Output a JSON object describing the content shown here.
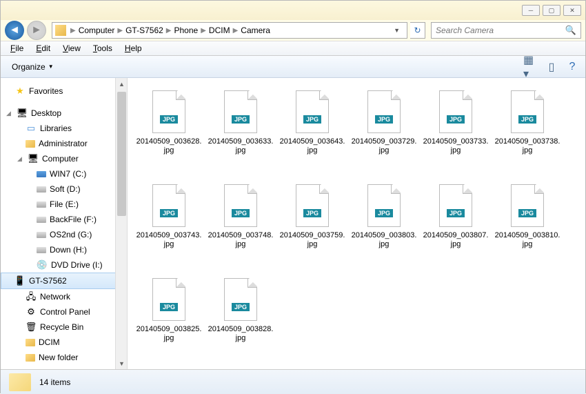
{
  "breadcrumbs": [
    "Computer",
    "GT-S7562",
    "Phone",
    "DCIM",
    "Camera"
  ],
  "search": {
    "placeholder": "Search Camera"
  },
  "menu": {
    "file": "File",
    "edit": "Edit",
    "view": "View",
    "tools": "Tools",
    "help": "Help"
  },
  "toolbar": {
    "organize": "Organize"
  },
  "sidebar": {
    "favorites": "Favorites",
    "desktop": "Desktop",
    "libraries": "Libraries",
    "administrator": "Administrator",
    "computer": "Computer",
    "win7": "WIN7 (C:)",
    "soft": "Soft (D:)",
    "filee": "File (E:)",
    "backfile": "BackFile (F:)",
    "os2nd": "OS2nd (G:)",
    "down": "Down (H:)",
    "dvd": "DVD Drive (I:)",
    "gts": "GT-S7562",
    "network": "Network",
    "cpanel": "Control Panel",
    "recycle": "Recycle Bin",
    "dcim": "DCIM",
    "newfolder": "New folder"
  },
  "files": [
    "20140509_003628.jpg",
    "20140509_003633.jpg",
    "20140509_003643.jpg",
    "20140509_003729.jpg",
    "20140509_003733.jpg",
    "20140509_003738.jpg",
    "20140509_003743.jpg",
    "20140509_003748.jpg",
    "20140509_003759.jpg",
    "20140509_003803.jpg",
    "20140509_003807.jpg",
    "20140509_003810.jpg",
    "20140509_003825.jpg",
    "20140509_003828.jpg"
  ],
  "file_badge": "JPG",
  "status": {
    "count": "14 items"
  }
}
